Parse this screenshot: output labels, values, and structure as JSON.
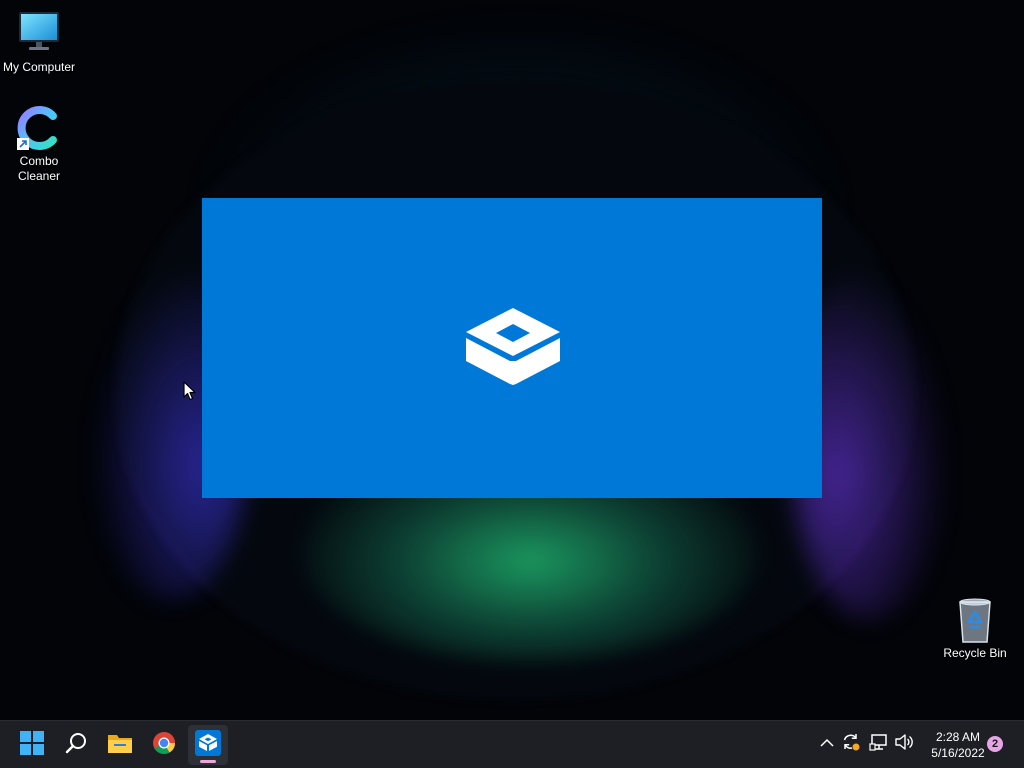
{
  "desktop": {
    "icons": [
      {
        "label": "My Computer",
        "icon": "monitor-icon"
      },
      {
        "label": "Combo Cleaner",
        "icon": "combo-cleaner-icon"
      },
      {
        "label": "Recycle Bin",
        "icon": "recycle-bin-icon"
      }
    ]
  },
  "splash": {
    "app": "Windows Sandbox",
    "icon": "sandbox-box-icon",
    "background_color": "#0078d7"
  },
  "taskbar": {
    "buttons": [
      {
        "name": "start",
        "icon": "windows-logo-icon"
      },
      {
        "name": "search",
        "icon": "search-icon"
      },
      {
        "name": "file-explorer",
        "icon": "folder-icon"
      },
      {
        "name": "chrome",
        "icon": "chrome-icon"
      },
      {
        "name": "windows-sandbox",
        "icon": "sandbox-box-icon",
        "active": true
      }
    ],
    "tray": [
      {
        "name": "show-hidden-icons",
        "icon": "chevron-up-icon"
      },
      {
        "name": "sync",
        "icon": "sync-icon"
      },
      {
        "name": "network",
        "icon": "network-icon"
      },
      {
        "name": "volume",
        "icon": "speaker-icon"
      }
    ],
    "clock": {
      "time": "2:28 AM",
      "date": "5/16/2022"
    },
    "notification_count": "2",
    "accent_color": "#e9a8d8"
  }
}
